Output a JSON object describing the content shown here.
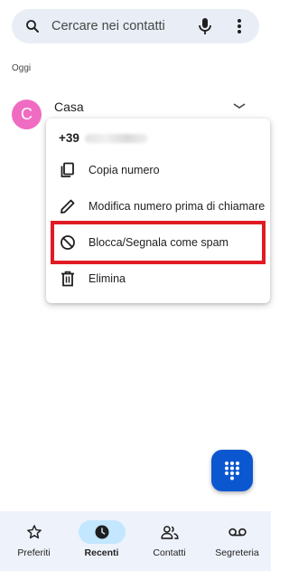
{
  "search": {
    "placeholder": "Cercare nei contatti",
    "icons": {
      "search": "search-icon",
      "mic": "mic-icon",
      "more": "more-vert-icon"
    }
  },
  "section_label": "Oggi",
  "call_entry": {
    "avatar_letter": "C",
    "avatar_color": "#f06cc2",
    "name": "Casa"
  },
  "menu": {
    "number_prefix": "+39",
    "items": [
      {
        "label": "Copia numero",
        "icon": "copy-icon"
      },
      {
        "label": "Modifica numero prima di chiamare",
        "icon": "edit-pencil-icon"
      },
      {
        "label": "Blocca/Segnala come spam",
        "icon": "block-icon"
      },
      {
        "label": "Elimina",
        "icon": "trash-icon"
      }
    ]
  },
  "fab": {
    "icon": "dialpad-icon",
    "color": "#0b57d0"
  },
  "bottom_nav": {
    "items": [
      {
        "label": "Preferiti",
        "icon": "star-icon",
        "active": false
      },
      {
        "label": "Recenti",
        "icon": "clock-icon",
        "active": true
      },
      {
        "label": "Contatti",
        "icon": "people-icon",
        "active": false
      },
      {
        "label": "Segreteria",
        "icon": "voicemail-icon",
        "active": false
      }
    ]
  },
  "colors": {
    "highlight_border": "#e01b24",
    "active_nav_pill": "#c2e7ff",
    "nav_background": "#eef2fa",
    "search_background": "#e9eef6"
  }
}
